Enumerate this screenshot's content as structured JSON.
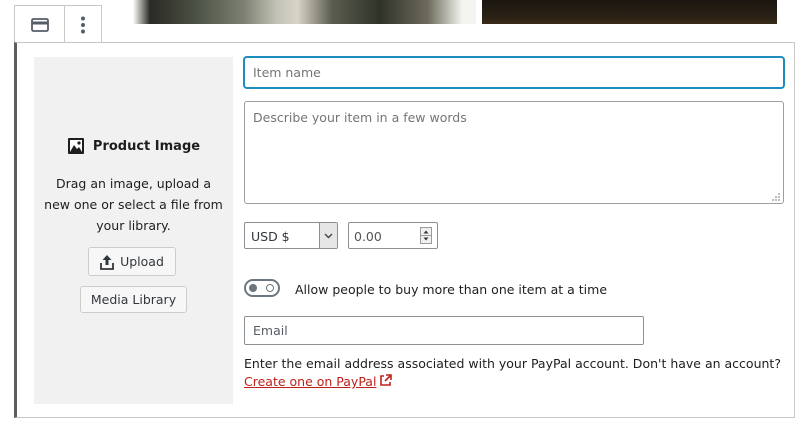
{
  "toolbar": {
    "block_icon": "block-card-icon",
    "more_icon": "more-vertical-icon"
  },
  "product_image": {
    "title": "Product Image",
    "instructions": "Drag an image, upload a new one or select a file from your library.",
    "upload_label": "Upload",
    "media_library_label": "Media Library"
  },
  "form": {
    "item_name_placeholder": "Item name",
    "description_placeholder": "Describe your item in a few words",
    "currency": "USD $",
    "price_placeholder": "0.00",
    "multiple_label": "Allow people to buy more than one item at a time",
    "email_placeholder": "Email",
    "help_text": "Enter the email address associated with your PayPal account. Don't have an account?",
    "help_link": "Create one on PayPal"
  },
  "colors": {
    "focus": "#1e8cbe",
    "link": "#c0201a",
    "panel_bg": "#f1f1f1"
  }
}
